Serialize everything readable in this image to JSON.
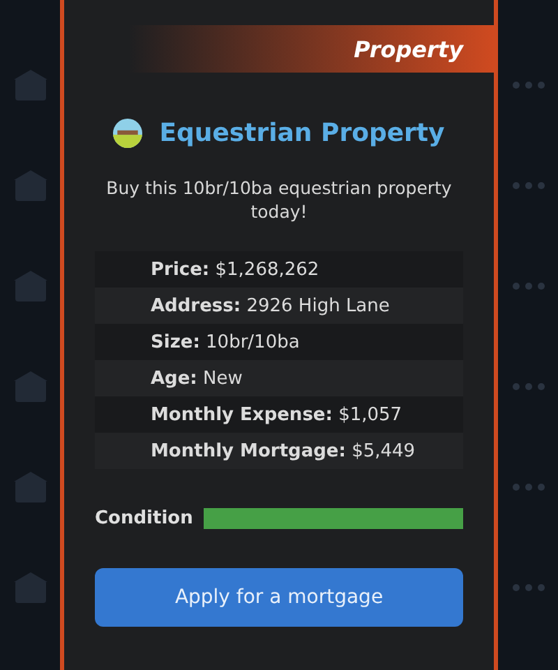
{
  "banner": {
    "label": "Property"
  },
  "title": "Equestrian Property",
  "description": "Buy this 10br/10ba equestrian property today!",
  "details": [
    {
      "label": "Price:",
      "value": "$1,268,262"
    },
    {
      "label": "Address:",
      "value": "2926 High Lane"
    },
    {
      "label": "Size:",
      "value": "10br/10ba"
    },
    {
      "label": "Age:",
      "value": "New"
    },
    {
      "label": "Monthly Expense:",
      "value": "$1,057"
    },
    {
      "label": "Monthly Mortgage:",
      "value": "$5,449"
    }
  ],
  "condition": {
    "label": "Condition",
    "level": 1
  },
  "buttons": [
    "Apply for a mortgage"
  ]
}
